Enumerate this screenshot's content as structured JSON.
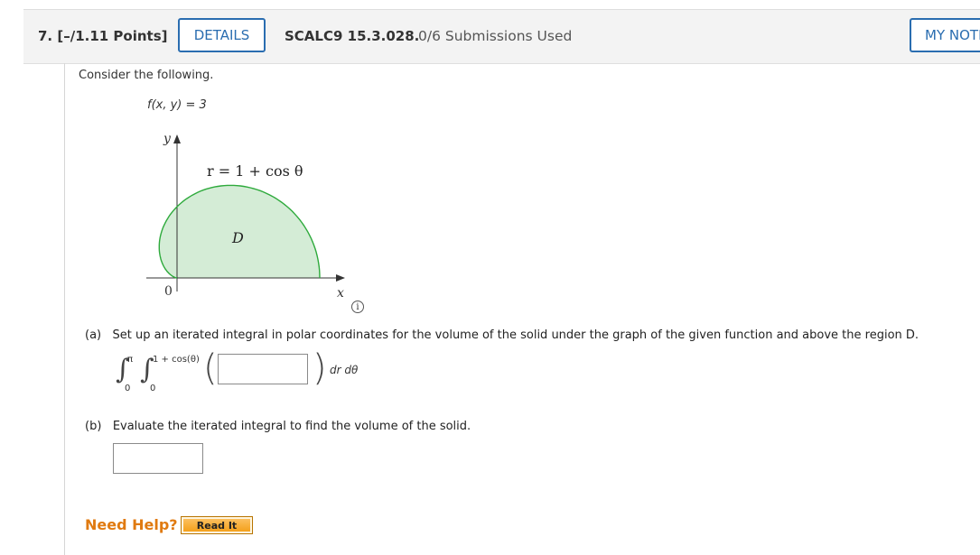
{
  "header": {
    "question_number": "7. [–/1.11 Points]",
    "details_label": "DETAILS",
    "question_code": "SCALC9 15.3.028.",
    "submissions": "0/6 Submissions Used",
    "my_notes_label": "MY NOTES"
  },
  "problem": {
    "intro": "Consider the following.",
    "function": "f(x, y) = 3"
  },
  "figure": {
    "y_axis_label": "y",
    "x_axis_label": "x",
    "origin_label": "0",
    "curve_label": "r = 1 + cos θ",
    "region_label": "D",
    "region_fill": "#d4ecd6",
    "curve_color": "#2eaa3c",
    "info_icon": "info-icon"
  },
  "part_a": {
    "label": "(a)",
    "text": "Set up an iterated integral in polar coordinates for the volume of the solid under the graph of the given function and above the region D.",
    "outer_upper": "π",
    "outer_lower": "0",
    "inner_upper": "1 + cos(θ)",
    "inner_lower": "0",
    "integrand_value": "",
    "differentials": "dr dθ"
  },
  "part_b": {
    "label": "(b)",
    "text": "Evaluate the iterated integral to find the volume of the solid.",
    "answer_value": ""
  },
  "help": {
    "need_help_label": "Need Help?",
    "read_it_label": "Read It"
  },
  "colors": {
    "accent": "#2a6db0",
    "help_orange": "#e07a10",
    "button_orange": "#f39c12"
  }
}
